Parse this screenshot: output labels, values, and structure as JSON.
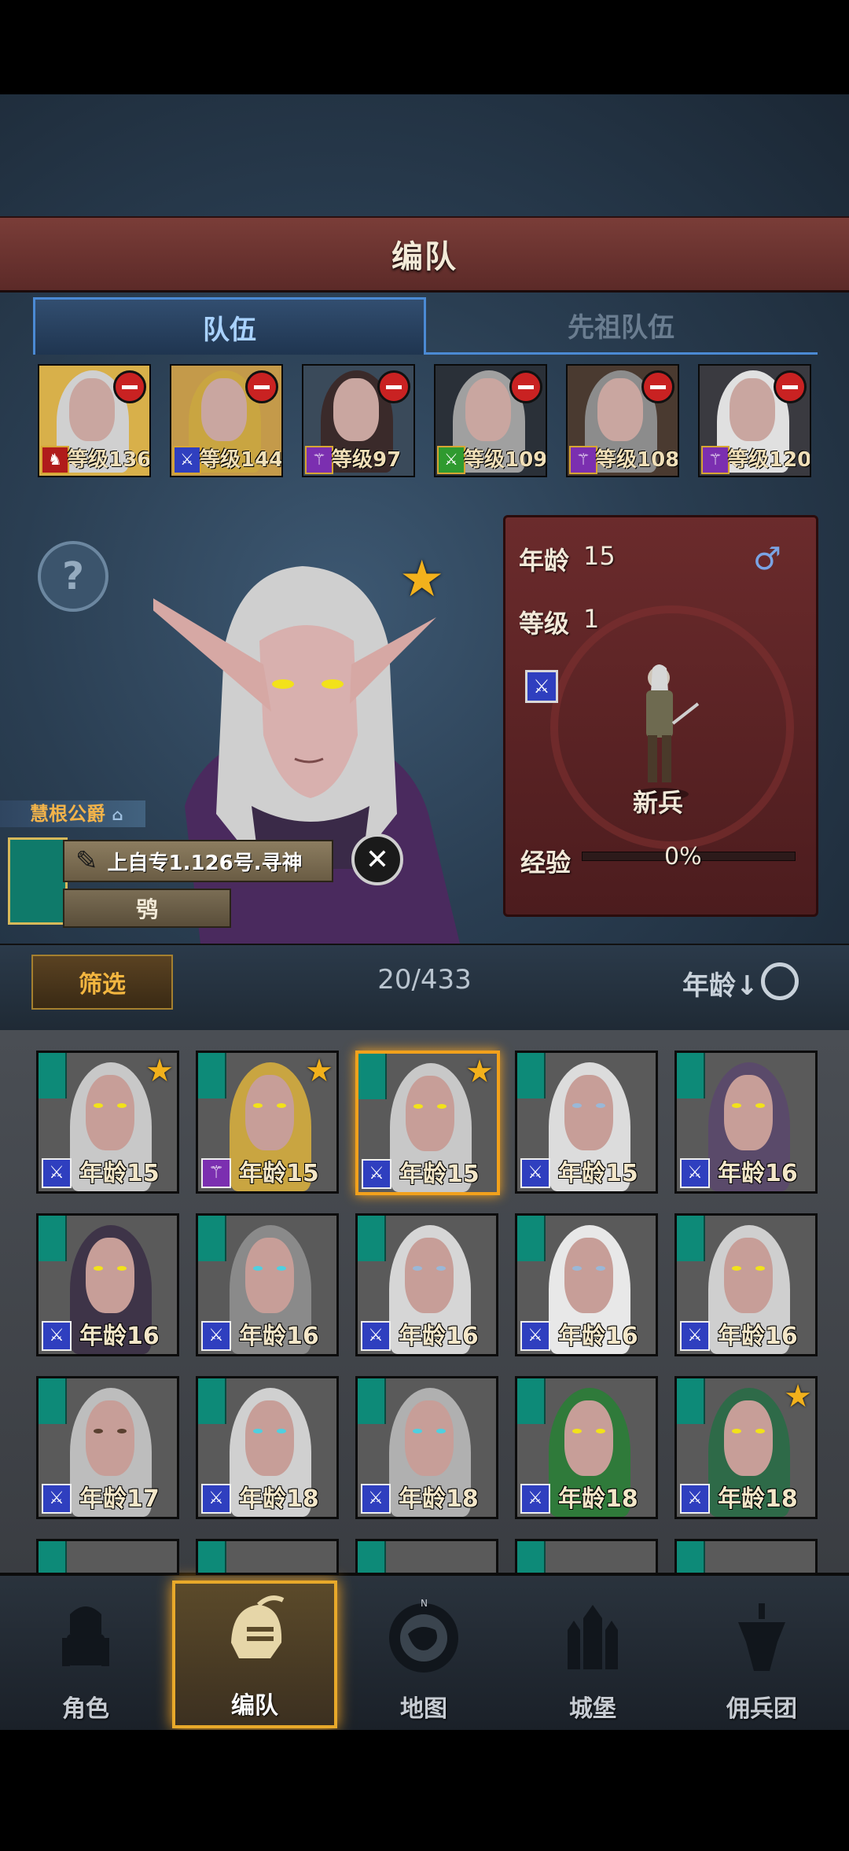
{
  "header": {
    "title": "编队"
  },
  "tabs": [
    {
      "label": "队伍"
    },
    {
      "label": "先祖队伍"
    }
  ],
  "team": [
    {
      "level": "等级136",
      "class_icon": "horse-icon",
      "class_color": "#b01b1b"
    },
    {
      "level": "等级144",
      "class_icon": "sword-icon",
      "class_color": "#2f3fbf"
    },
    {
      "level": "等级97",
      "class_icon": "staff-icon",
      "class_color": "#7b2fb0"
    },
    {
      "level": "等级109",
      "class_icon": "sword-icon",
      "class_color": "#2f9a2f"
    },
    {
      "level": "等级108",
      "class_icon": "staff-icon",
      "class_color": "#7b2fb0"
    },
    {
      "level": "等级120",
      "class_icon": "staff-icon",
      "class_color": "#7b2fb0"
    }
  ],
  "detail": {
    "age_label": "年龄",
    "age_value": "15",
    "level_label": "等级",
    "level_value": "1",
    "rank": "新兵",
    "exp_label": "经验",
    "exp_value": "0%",
    "noble_title": "慧根公爵",
    "name": "上自专1.126号.寻神",
    "subname": "鸮"
  },
  "list_header": {
    "filter_label": "筛选",
    "count": "20/433",
    "sort_label": "年龄↓"
  },
  "roster": [
    {
      "age": "年龄15",
      "star": true,
      "hair": "#c8c8c8",
      "eye": "#f2e21a",
      "class_color": "#2f3fbf"
    },
    {
      "age": "年龄15",
      "star": true,
      "hair": "#c9a541",
      "eye": "#f2e21a",
      "class_color": "#7b2fb0"
    },
    {
      "age": "年龄15",
      "star": true,
      "hair": "#c8c8c8",
      "eye": "#f2e21a",
      "class_color": "#2f3fbf",
      "selected": true
    },
    {
      "age": "年龄15",
      "star": false,
      "hair": "#dcdcdc",
      "eye": "#9ab8d8",
      "class_color": "#2f3fbf"
    },
    {
      "age": "年龄16",
      "star": false,
      "hair": "#5a4a6a",
      "eye": "#f2e21a",
      "class_color": "#2f3fbf"
    },
    {
      "age": "年龄16",
      "star": false,
      "hair": "#3e3448",
      "eye": "#f2e21a",
      "class_color": "#2f3fbf"
    },
    {
      "age": "年龄16",
      "star": false,
      "hair": "#8a8a8a",
      "eye": "#4fd0e0",
      "class_color": "#2f3fbf"
    },
    {
      "age": "年龄16",
      "star": false,
      "hair": "#d6d6d6",
      "eye": "#9ab8d8",
      "class_color": "#2f3fbf"
    },
    {
      "age": "年龄16",
      "star": false,
      "hair": "#e8e8e8",
      "eye": "#9ab8d8",
      "class_color": "#2f3fbf"
    },
    {
      "age": "年龄16",
      "star": false,
      "hair": "#cfcfcf",
      "eye": "#f2e21a",
      "class_color": "#2f3fbf"
    },
    {
      "age": "年龄17",
      "star": false,
      "hair": "#bdbdbd",
      "eye": "#5a4030",
      "class_color": "#2f3fbf"
    },
    {
      "age": "年龄18",
      "star": false,
      "hair": "#d0d0d0",
      "eye": "#4fd0e0",
      "class_color": "#2f3fbf"
    },
    {
      "age": "年龄18",
      "star": false,
      "hair": "#b0b0b0",
      "eye": "#4fd0e0",
      "class_color": "#2f3fbf"
    },
    {
      "age": "年龄18",
      "star": false,
      "hair": "#2f7a3a",
      "eye": "#f2e21a",
      "class_color": "#2f3fbf"
    },
    {
      "age": "年龄18",
      "star": true,
      "hair": "#2e6a48",
      "eye": "#f2e21a",
      "class_color": "#2f3fbf"
    }
  ],
  "nav": [
    {
      "label": "角色",
      "icon": "knight-icon"
    },
    {
      "label": "编队",
      "icon": "helmet-icon",
      "active": true
    },
    {
      "label": "地图",
      "icon": "compass-map-icon"
    },
    {
      "label": "城堡",
      "icon": "castle-icon"
    },
    {
      "label": "佣兵团",
      "icon": "mercenary-icon"
    }
  ]
}
